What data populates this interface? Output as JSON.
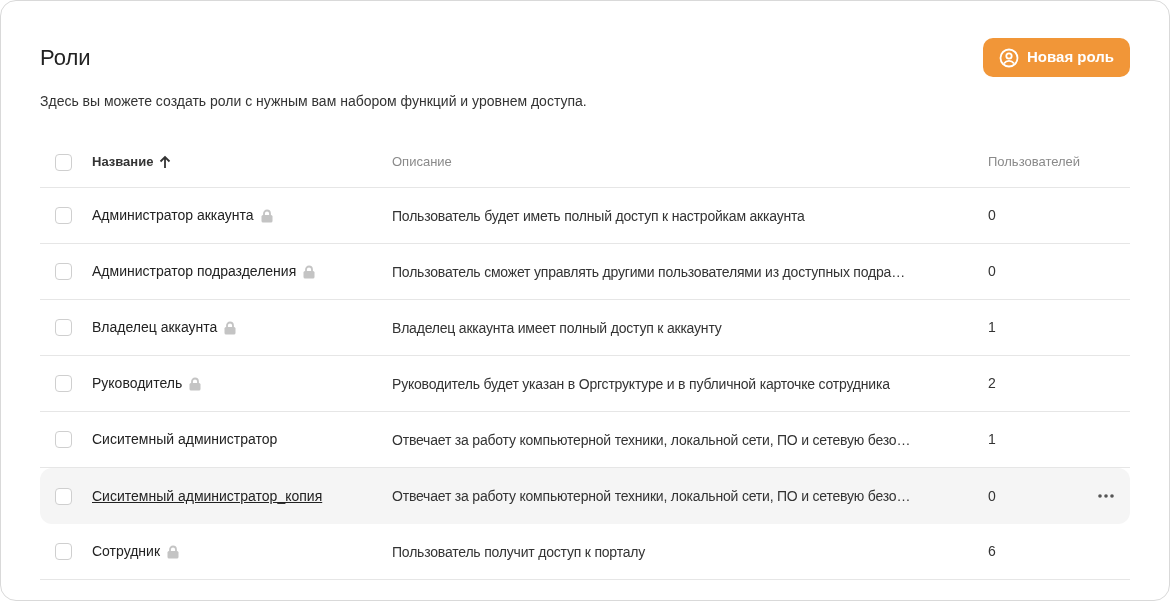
{
  "title": "Роли",
  "new_button": {
    "label": "Новая роль"
  },
  "subtitle": "Здесь вы можете создать роли с нужным вам набором функций и уровнем доступа.",
  "table": {
    "select_all": {
      "checked": false
    },
    "columns": [
      {
        "label": "Название",
        "sorted": true
      },
      {
        "label": "Описание",
        "sorted": false
      },
      {
        "label": "Пользователей",
        "sorted": false
      }
    ],
    "rows": [
      {
        "name": "Администратор аккаунта",
        "locked": true,
        "description": "Пользователь будет иметь полный доступ к настройкам аккаунта",
        "users": "0",
        "checked": false,
        "hovered": false
      },
      {
        "name": "Администратор подразделения",
        "locked": true,
        "description": "Пользователь сможет управлять другими пользователями из доступных подра…",
        "users": "0",
        "checked": false,
        "hovered": false
      },
      {
        "name": "Владелец аккаунта",
        "locked": true,
        "description": "Владелец аккаунта имеет полный доступ к аккаунту",
        "users": "1",
        "checked": false,
        "hovered": false
      },
      {
        "name": "Руководитель",
        "locked": true,
        "description": "Руководитель будет указан в Оргструктуре и в публичной карточке сотрудника",
        "users": "2",
        "checked": false,
        "hovered": false
      },
      {
        "name": "Сиситемный администратор",
        "locked": false,
        "description": "Отвечает за работу компьютерной техники, локальной сети, ПО и сетевую безо…",
        "users": "1",
        "checked": false,
        "hovered": false
      },
      {
        "name": "Сиситемный администратор_копия",
        "locked": false,
        "description": "Отвечает за работу компьютерной техники, локальной сети, ПО и сетевую безо…",
        "users": "0",
        "checked": false,
        "hovered": true
      },
      {
        "name": "Сотрудник",
        "locked": true,
        "description": "Пользователь получит доступ к порталу",
        "users": "6",
        "checked": false,
        "hovered": false
      }
    ]
  }
}
